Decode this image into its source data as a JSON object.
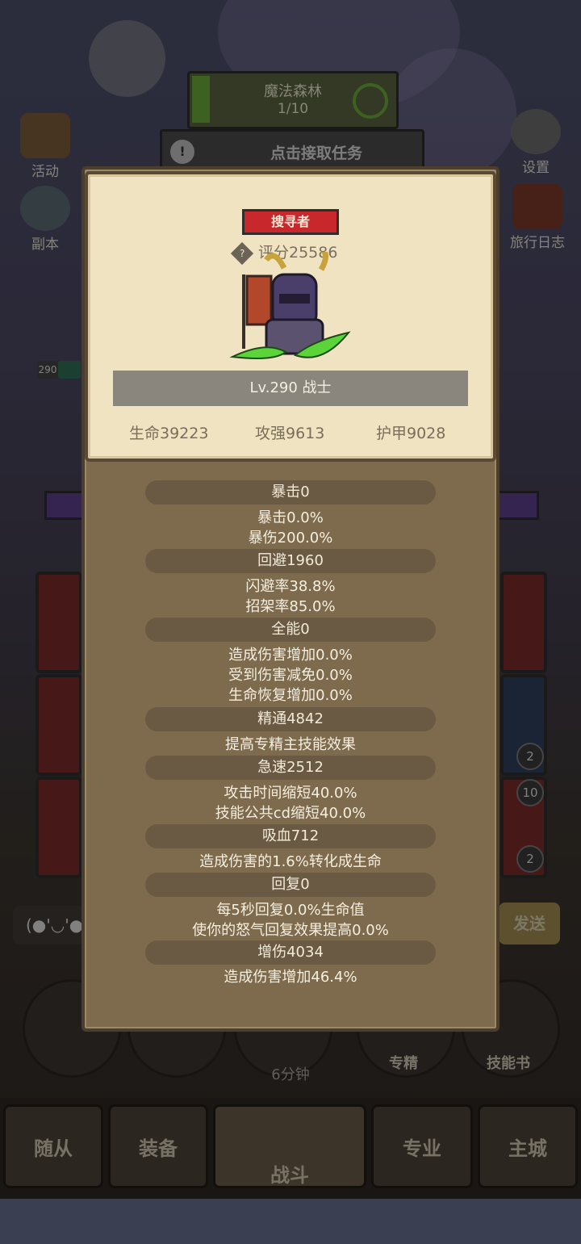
{
  "quest": {
    "name": "魔法森林",
    "progress": "1/10",
    "task_label": "点击接取任务",
    "task_icon": "!"
  },
  "side": {
    "activity": "活动",
    "dungeon": "副本",
    "settings": "设置",
    "journal": "旅行日志"
  },
  "level_tag": "290",
  "chat": {
    "emoticon": "(●'◡'●",
    "send": "发送"
  },
  "bottom_circles": {
    "specialization": "专精",
    "skill_book": "技能书",
    "timer": "6分钟"
  },
  "badges": [
    "2",
    "10",
    "2"
  ],
  "nav": {
    "follower": "随从",
    "equipment": "装备",
    "battle": "战斗",
    "profession": "专业",
    "main_city": "主城"
  },
  "character": {
    "title": "搜寻者",
    "score_icon": "?",
    "score": "评分25586",
    "level_class": "Lv.290 战士",
    "hp": "生命39223",
    "attack": "攻强9613",
    "armor": "护甲9028"
  },
  "stats": [
    {
      "header": "暴击0",
      "lines": [
        "暴击0.0%",
        "暴伤200.0%"
      ]
    },
    {
      "header": "回避1960",
      "lines": [
        "闪避率38.8%",
        "招架率85.0%"
      ]
    },
    {
      "header": "全能0",
      "lines": [
        "造成伤害增加0.0%",
        "受到伤害减免0.0%",
        "生命恢复增加0.0%"
      ]
    },
    {
      "header": "精通4842",
      "lines": [
        "提高专精主技能效果"
      ]
    },
    {
      "header": "急速2512",
      "lines": [
        "攻击时间缩短40.0%",
        "技能公共cd缩短40.0%"
      ]
    },
    {
      "header": "吸血712",
      "lines": [
        "造成伤害的1.6%转化成生命"
      ]
    },
    {
      "header": "回复0",
      "lines": [
        "每5秒回复0.0%生命值",
        "使你的怒气回复效果提高0.0%"
      ]
    },
    {
      "header": "增伤4034",
      "lines": [
        "造成伤害增加46.4%"
      ]
    }
  ]
}
